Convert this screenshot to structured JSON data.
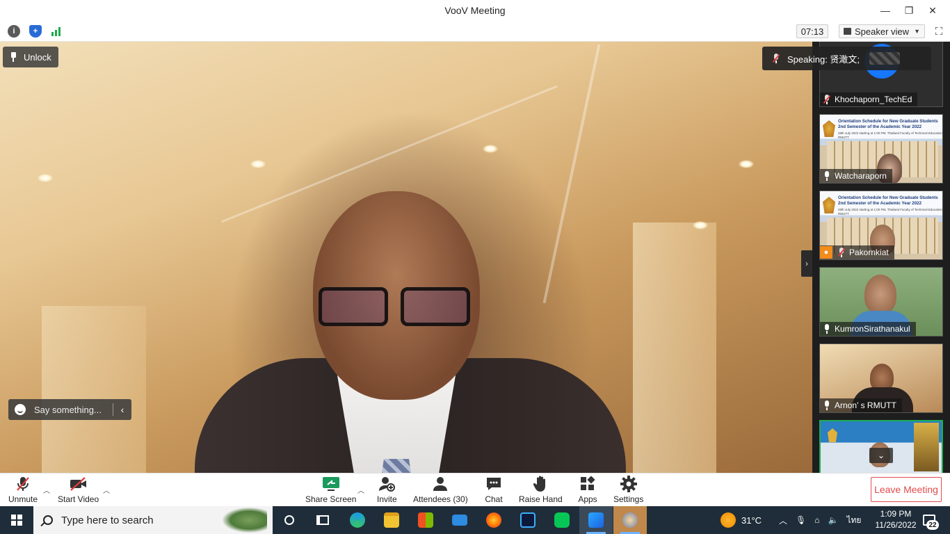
{
  "window": {
    "title": "VooV Meeting",
    "minimize": "—",
    "restore": "❐",
    "close": "✕"
  },
  "infobar": {
    "info_icon": "info-icon",
    "security_icon": "shield-icon",
    "signal_icon": "signal-icon",
    "timer": "07:13",
    "view_label": "Speaker view",
    "fullscreen_icon": "fullscreen-icon"
  },
  "main_video": {
    "unlock_label": "Unlock",
    "chat_placeholder": "Say something...",
    "speaking_label": "Speaking: 贤澉文;"
  },
  "participants": [
    {
      "name": "Khochaporn_TechEd",
      "muted": true
    },
    {
      "name": "Watcharaporn",
      "muted": false,
      "slide_title": "Orientation Schedule for New Graduate Students 2nd Semester of the Academic Year 2022",
      "slide_sub": "28th July 2022 starting at 1:00 PM, Thailand\nFaculty of Technical Education RMUTT"
    },
    {
      "name": "Pakornkiat",
      "muted": true,
      "host": true,
      "slide_title": "Orientation Schedule for New Graduate Students 2nd Semester of the Academic Year 2022",
      "slide_sub": "28th July 2022 starting at 1:00 PM, Thailand\nFaculty of Technical Education RMUTT"
    },
    {
      "name": "KumronSirathanakul",
      "muted": false
    },
    {
      "name": "Arnon’ s RMUTT",
      "muted": false
    }
  ],
  "toolbar": {
    "unmute": "Unmute",
    "start_video": "Start Video",
    "share_screen": "Share Screen",
    "invite": "Invite",
    "attendees": "Attendees (30)",
    "chat": "Chat",
    "raise_hand": "Raise Hand",
    "apps": "Apps",
    "settings": "Settings",
    "leave": "Leave Meeting"
  },
  "taskbar": {
    "search_placeholder": "Type here to search",
    "weather": "31°C",
    "language": "ไทย",
    "time": "1:09 PM",
    "date": "11/26/2022",
    "notifications": "22"
  },
  "colors": {
    "accent_red": "#e14b4b",
    "taskbar": "#1f2d3a",
    "line_green": "#06c755",
    "edge_blue": "#1b9de2"
  }
}
